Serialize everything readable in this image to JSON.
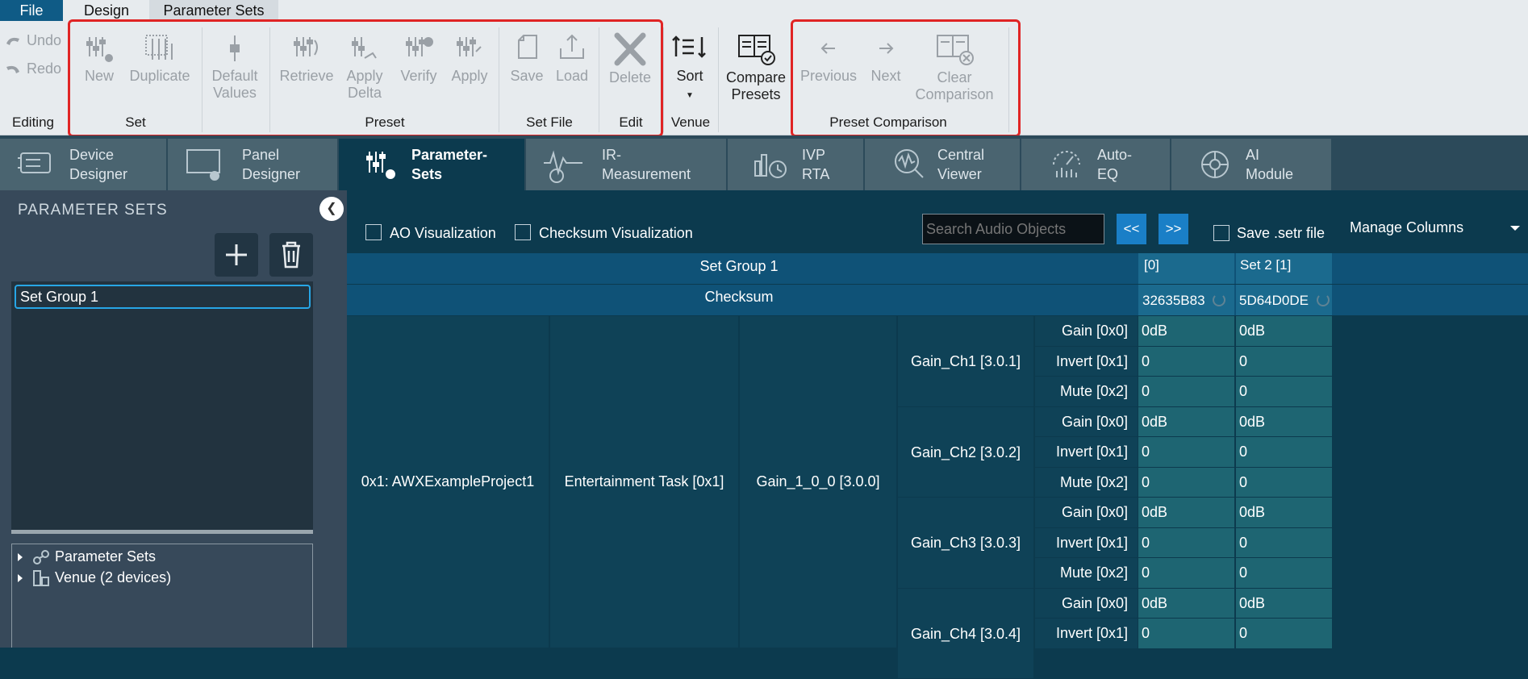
{
  "menu": {
    "file": "File",
    "design": "Design",
    "parameter_sets": "Parameter Sets"
  },
  "ribbon": {
    "undo": "Undo",
    "redo": "Redo",
    "editing_group": "Editing",
    "new": "New",
    "duplicate": "Duplicate",
    "default_values": [
      "Default",
      "Values"
    ],
    "set_group": "Set",
    "retrieve": "Retrieve",
    "apply_delta": [
      "Apply",
      "Delta"
    ],
    "verify": "Verify",
    "apply": "Apply",
    "preset_group": "Preset",
    "save": "Save",
    "load": "Load",
    "setfile_group": "Set File",
    "delete": "Delete",
    "edit_group": "Edit",
    "sort": "Sort",
    "venue_group": "Venue",
    "compare_presets": [
      "Compare",
      "Presets"
    ],
    "previous": "Previous",
    "next": "Next",
    "clear_comparison": [
      "Clear",
      "Comparison"
    ],
    "comparison_group": "Preset Comparison"
  },
  "nav_tabs": [
    {
      "line1": "Device",
      "line2": "Designer"
    },
    {
      "line1": "Panel",
      "line2": "Designer"
    },
    {
      "line1": "Parameter-",
      "line2": "Sets"
    },
    {
      "line1": "IR-",
      "line2": "Measurement"
    },
    {
      "line1": "IVP",
      "line2": "RTA"
    },
    {
      "line1": "Central",
      "line2": "Viewer"
    },
    {
      "line1": "Auto-",
      "line2": "EQ"
    },
    {
      "line1": "AI",
      "line2": "Module"
    }
  ],
  "left": {
    "title": "PARAMETER SETS",
    "set_item": "Set Group 1",
    "tree": [
      "Parameter Sets",
      "Venue (2 devices)"
    ]
  },
  "toolbar": {
    "ao_vis": "AO Visualization",
    "checksum_vis": "Checksum Visualization",
    "search_placeholder": "Search Audio Objects",
    "prev_btn": "<<",
    "next_btn": ">>",
    "save_setr": "Save .setr file",
    "manage_columns": "Manage Columns"
  },
  "grid": {
    "set_group_label": "Set Group 1",
    "checksum_label": "Checksum",
    "columns": [
      {
        "name": "[0]",
        "checksum": "32635B83"
      },
      {
        "name": "Set 2 [1]",
        "checksum": "5D64D0DE"
      }
    ],
    "project": "0x1: AWXExampleProject1",
    "task": "Entertainment Task [0x1]",
    "object": "Gain_1_0_0 [3.0.0]",
    "channels": [
      {
        "name": "Gain_Ch1 [3.0.1]",
        "params": [
          {
            "p": "Gain [0x0]",
            "v0": "0dB",
            "v1": "0dB"
          },
          {
            "p": "Invert [0x1]",
            "v0": "0",
            "v1": "0"
          },
          {
            "p": "Mute [0x2]",
            "v0": "0",
            "v1": "0"
          }
        ]
      },
      {
        "name": "Gain_Ch2 [3.0.2]",
        "params": [
          {
            "p": "Gain [0x0]",
            "v0": "0dB",
            "v1": "0dB"
          },
          {
            "p": "Invert [0x1]",
            "v0": "0",
            "v1": "0"
          },
          {
            "p": "Mute [0x2]",
            "v0": "0",
            "v1": "0"
          }
        ]
      },
      {
        "name": "Gain_Ch3 [3.0.3]",
        "params": [
          {
            "p": "Gain [0x0]",
            "v0": "0dB",
            "v1": "0dB"
          },
          {
            "p": "Invert [0x1]",
            "v0": "0",
            "v1": "0"
          },
          {
            "p": "Mute [0x2]",
            "v0": "0",
            "v1": "0"
          }
        ]
      },
      {
        "name": "Gain_Ch4 [3.0.4]",
        "params": [
          {
            "p": "Gain [0x0]",
            "v0": "0dB",
            "v1": "0dB"
          },
          {
            "p": "Invert [0x1]",
            "v0": "0",
            "v1": "0"
          }
        ]
      }
    ]
  }
}
